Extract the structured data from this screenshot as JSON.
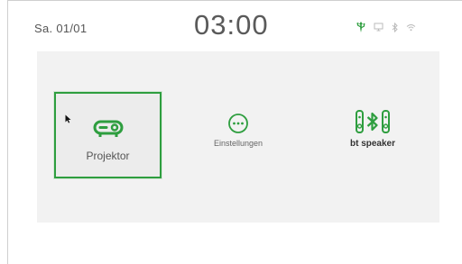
{
  "header": {
    "date": "Sa. 01/01",
    "time": "03:00"
  },
  "status_icons": [
    {
      "icon": "usb-icon",
      "color": "#2e9e3f"
    },
    {
      "icon": "display-icon",
      "color": "#bbbbbb"
    },
    {
      "icon": "bluetooth-icon",
      "color": "#bbbbbb"
    },
    {
      "icon": "wifi-icon",
      "color": "#bbbbbb"
    }
  ],
  "tiles": [
    {
      "label": "Projektor",
      "icon": "projector-icon",
      "selected": true
    },
    {
      "label": "Einstellungen",
      "icon": "more-options-icon",
      "selected": false
    },
    {
      "label": "bt speaker",
      "icon": "bluetooth-speaker-icon",
      "selected": false
    }
  ],
  "colors": {
    "accent": "#2e9e3f",
    "panel_background": "#f2f2f2",
    "text": "#555555",
    "inactive_icon": "#bbbbbb"
  }
}
